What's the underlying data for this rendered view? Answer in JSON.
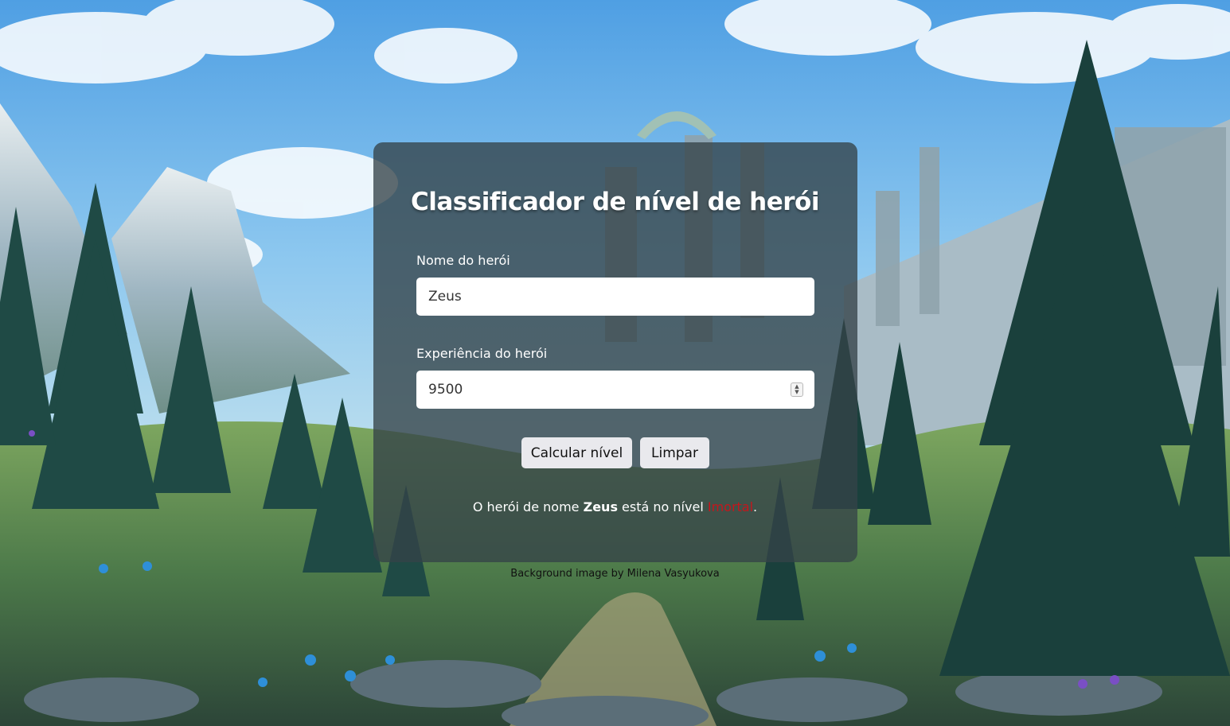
{
  "page": {
    "title": "Classificador de nível de herói",
    "credit": "Background image by Milena Vasyukova"
  },
  "form": {
    "name_label": "Nome do herói",
    "name_value": "Zeus",
    "xp_label": "Experiência do herói",
    "xp_value": "9500"
  },
  "buttons": {
    "calculate_label": "Calcular nível",
    "clear_label": "Limpar"
  },
  "result": {
    "prefix": "O herói de nome ",
    "hero_name": "Zeus",
    "middle": " está no nível ",
    "level": "Imortal",
    "suffix": "."
  },
  "colors": {
    "card_bg": "#344248",
    "level_text": "#c4161c",
    "button_bg": "#e9e9ed"
  }
}
